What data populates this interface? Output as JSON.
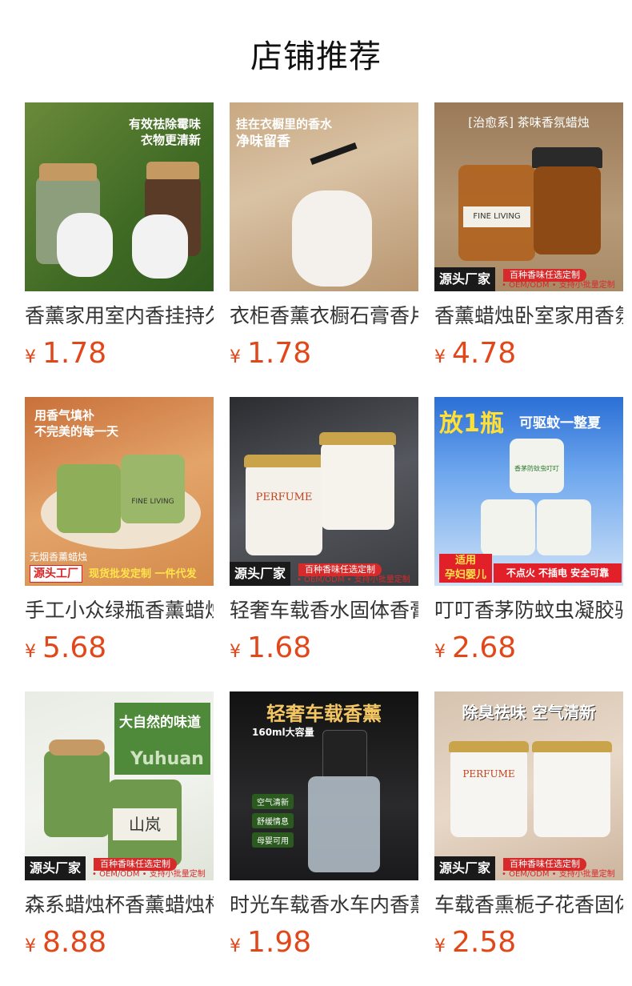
{
  "header": {
    "title": "店铺推荐"
  },
  "currency": "¥",
  "products": [
    {
      "name": "香薰家用室内香挂持久",
      "price": "1.78",
      "overlay": [
        "有效祛除霉味",
        "衣物更清新"
      ]
    },
    {
      "name": "衣柜香薰衣橱石膏香片",
      "price": "1.78",
      "overlay": [
        "挂在衣橱里的香水",
        "净味留香"
      ]
    },
    {
      "name": "香薰蜡烛卧室家用香氛",
      "price": "4.78",
      "overlay": [
        "[治愈系] 茶味香氛蜡烛",
        "FINE LIVING",
        "源头厂家",
        "百种香味任选定制",
        "• OEM/ODM • 支持小批量定制"
      ]
    },
    {
      "name": "手工小众绿瓶香薰蜡烛",
      "price": "5.68",
      "overlay": [
        "用香气填补",
        "不完美的每一天",
        "FINE LIVING",
        "无烟香薰蜡烛",
        "源头工厂",
        "现货批发定制 一件代发"
      ]
    },
    {
      "name": "轻奢车载香水固体香膏",
      "price": "1.68",
      "overlay": [
        "PERFUME",
        "源头厂家",
        "百种香味任选定制",
        "• OEM/ODM • 支持小批量定制"
      ]
    },
    {
      "name": "叮叮香茅防蚊虫凝胶驱",
      "price": "2.68",
      "overlay": [
        "放1瓶",
        "可驱蚊一整夏",
        "香茅防蚊虫叮叮",
        "适用",
        "孕妇婴儿",
        "不点火 不插电 安全可靠"
      ]
    },
    {
      "name": "森系蜡烛杯香薰蜡烛杯",
      "price": "8.88",
      "overlay": [
        "大自然的味道",
        "Yuhuan",
        "山岚",
        "源头厂家",
        "百种香味任选定制",
        "• OEM/ODM • 支持小批量定制"
      ]
    },
    {
      "name": "时光车载香水车内香薰",
      "price": "1.98",
      "overlay": [
        "轻奢车载香薰",
        "160ml大容量",
        "空气清新",
        "舒缓情息",
        "母婴可用"
      ]
    },
    {
      "name": "车载香熏栀子花香固体",
      "price": "2.58",
      "overlay": [
        "除臭祛味 空气清新",
        "PERFUME",
        "源头厂家",
        "百种香味任选定制",
        "• OEM/ODM • 支持小批量定制"
      ]
    }
  ]
}
